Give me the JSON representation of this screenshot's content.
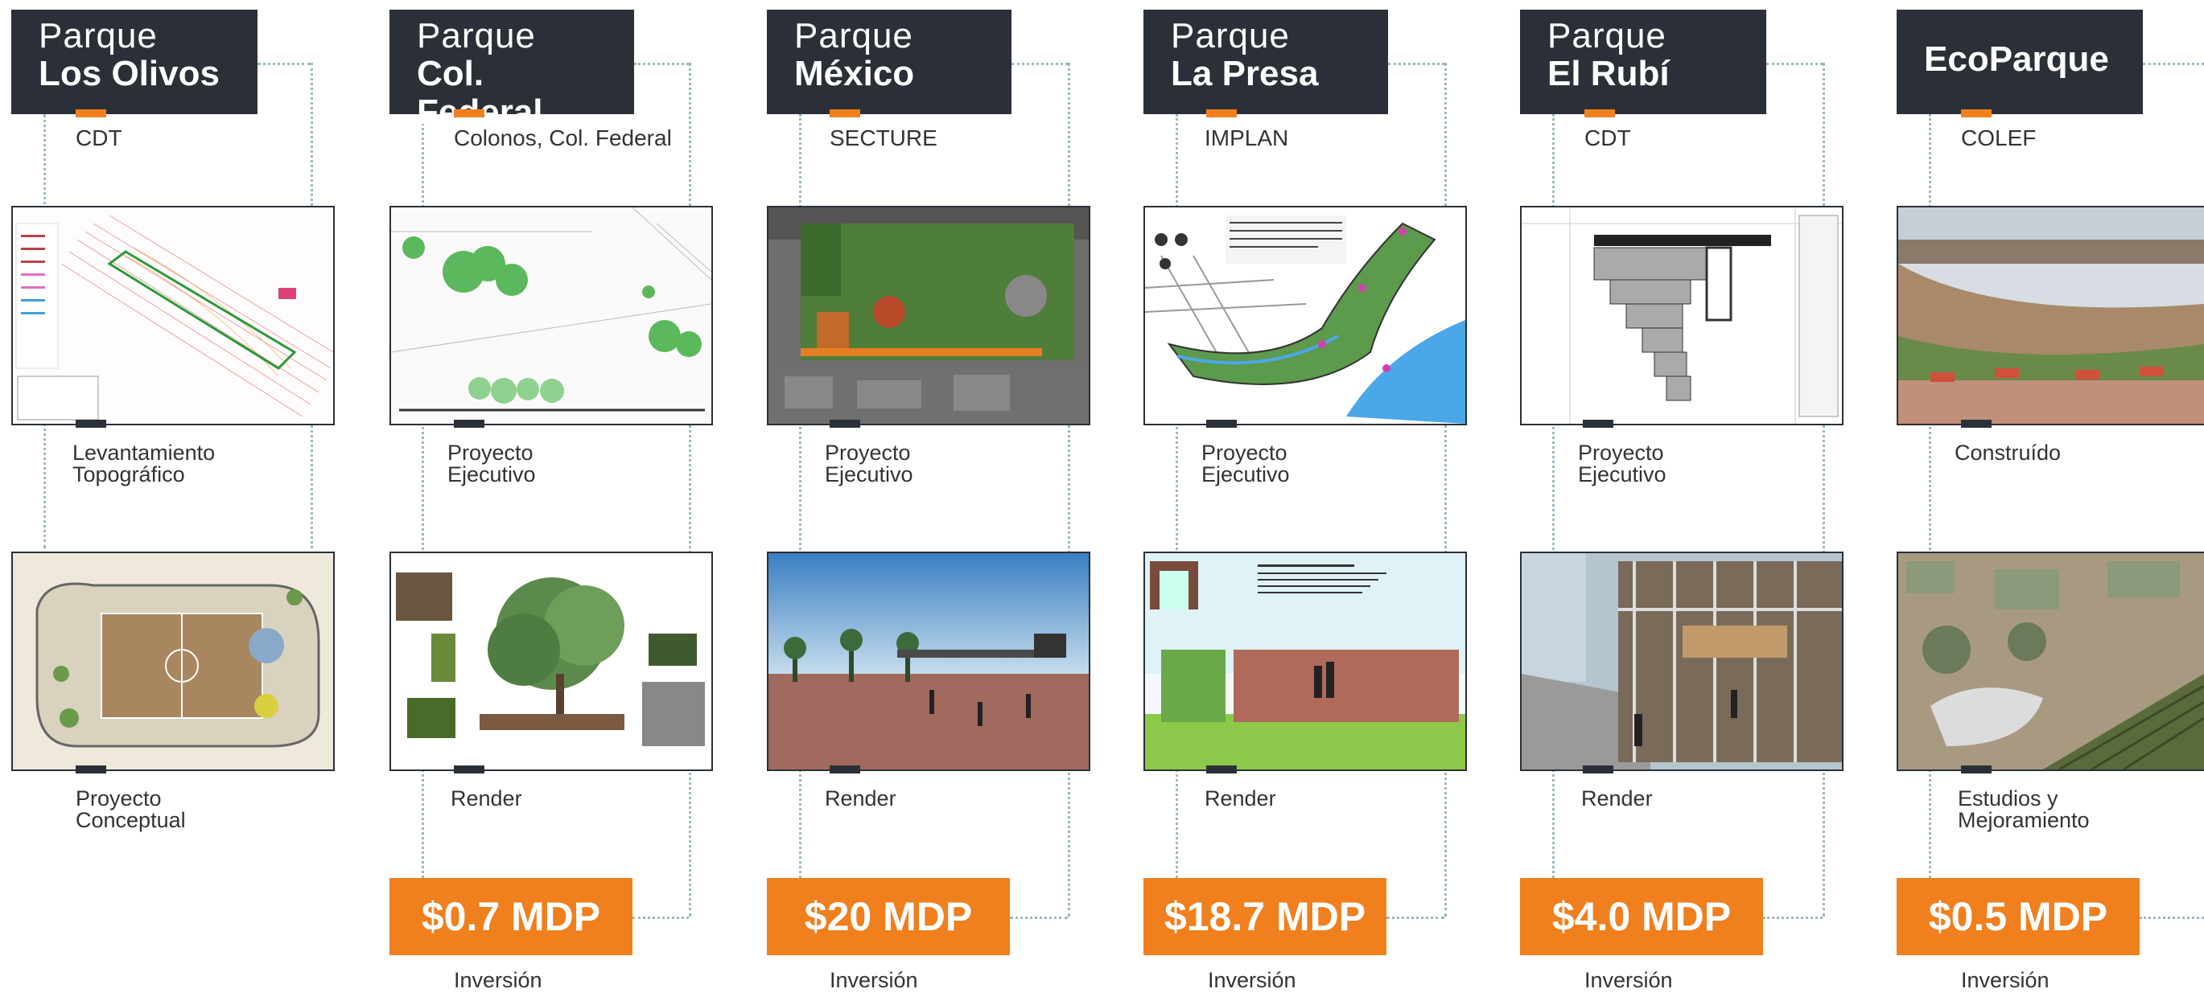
{
  "colors": {
    "dark": "#2b3038",
    "accent": "#f07f1e",
    "dotted": "#9db8c0"
  },
  "parks": [
    {
      "title_line1": "Parque",
      "title_line2": "Los Olivos",
      "owner": "CDT",
      "top_caption_1": "Levantamiento",
      "top_caption_2": "Topográfico",
      "bottom_caption_1": "Proyecto",
      "bottom_caption_2": "Conceptual",
      "investment": "",
      "investment_label": ""
    },
    {
      "title_line1": "Parque",
      "title_line2": "Col. Federal",
      "owner": "Colonos, Col. Federal",
      "top_caption_1": "Proyecto",
      "top_caption_2": "Ejecutivo",
      "bottom_caption_1": "Render",
      "bottom_caption_2": "",
      "investment": "$0.7 MDP",
      "investment_label": "Inversión"
    },
    {
      "title_line1": "Parque",
      "title_line2": "México",
      "owner": "SECTURE",
      "top_caption_1": "Proyecto",
      "top_caption_2": "Ejecutivo",
      "bottom_caption_1": "Render",
      "bottom_caption_2": "",
      "investment": "$20 MDP",
      "investment_label": "Inversión"
    },
    {
      "title_line1": "Parque",
      "title_line2": "La Presa",
      "owner": "IMPLAN",
      "top_caption_1": "Proyecto",
      "top_caption_2": "Ejecutivo",
      "bottom_caption_1": "Render",
      "bottom_caption_2": "",
      "investment": "$18.7 MDP",
      "investment_label": "Inversión"
    },
    {
      "title_line1": "Parque",
      "title_line2": "El Rubí",
      "owner": "CDT",
      "top_caption_1": "Proyecto",
      "top_caption_2": "Ejecutivo",
      "bottom_caption_1": "Render",
      "bottom_caption_2": "",
      "investment": "$4.0 MDP",
      "investment_label": "Inversión"
    },
    {
      "title_line1": "",
      "title_line2": "EcoParque",
      "owner": "COLEF",
      "top_caption_1": "Construído",
      "top_caption_2": "",
      "bottom_caption_1": "Estudios y",
      "bottom_caption_2": "Mejoramiento",
      "investment": "$0.5 MDP",
      "investment_label": "Inversión"
    }
  ]
}
